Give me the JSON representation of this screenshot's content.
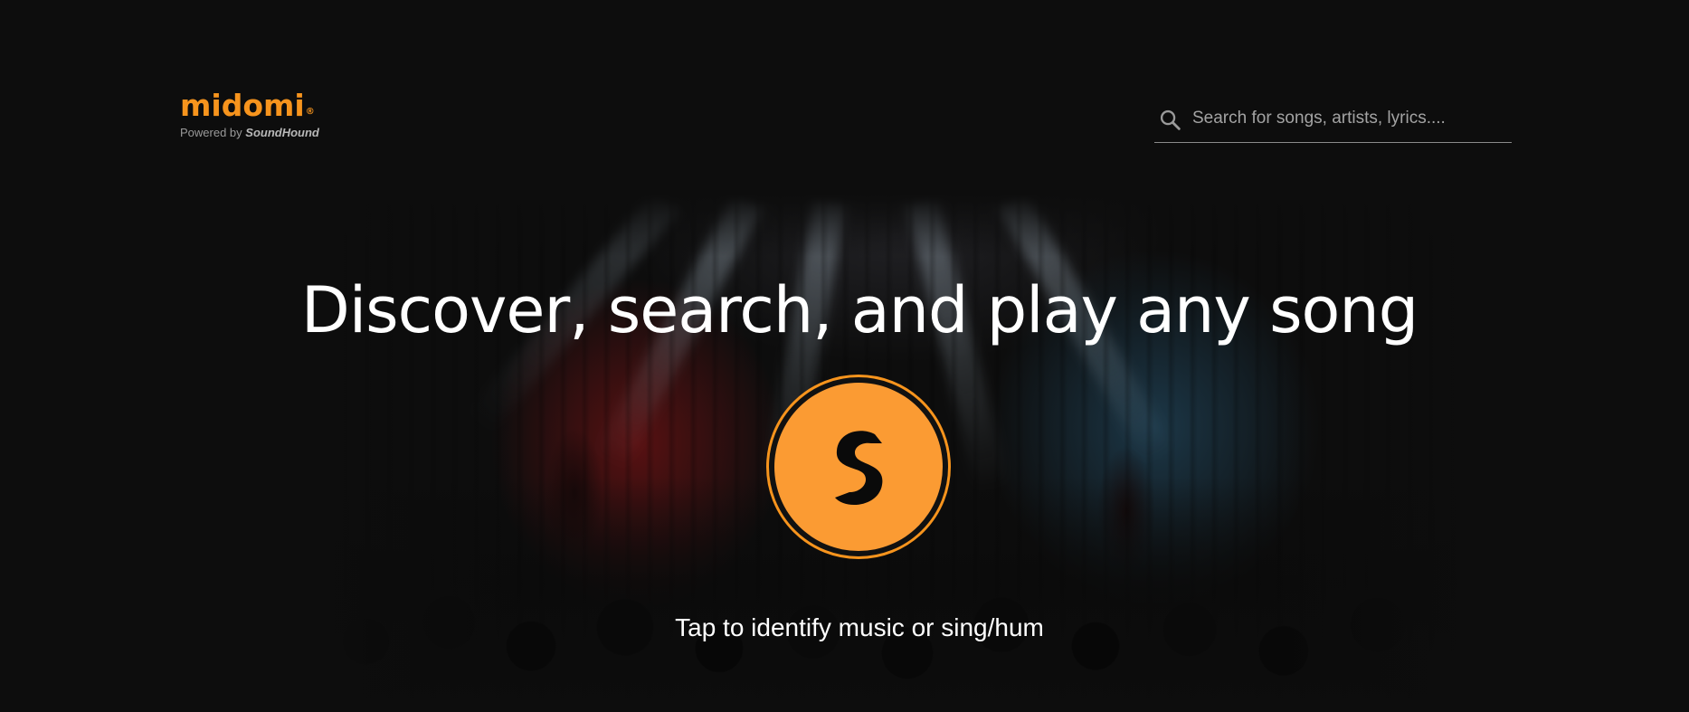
{
  "logo": {
    "wordmark": "midomi",
    "registered": "®",
    "powered_by": "Powered by",
    "powered_brand": "SoundHound"
  },
  "search": {
    "placeholder": "Search for songs, artists, lyrics....",
    "value": "",
    "icon": "search-icon"
  },
  "hero": {
    "headline": "Discover, search, and play any song",
    "listen_icon": "soundhound-icon",
    "tap_label": "Tap to identify music or sing/hum"
  },
  "colors": {
    "background": "#0d0d0d",
    "brand_orange": "#f7941d",
    "button_orange": "#fb9b33",
    "text": "#ffffff",
    "muted_text": "#a3a3a3"
  }
}
